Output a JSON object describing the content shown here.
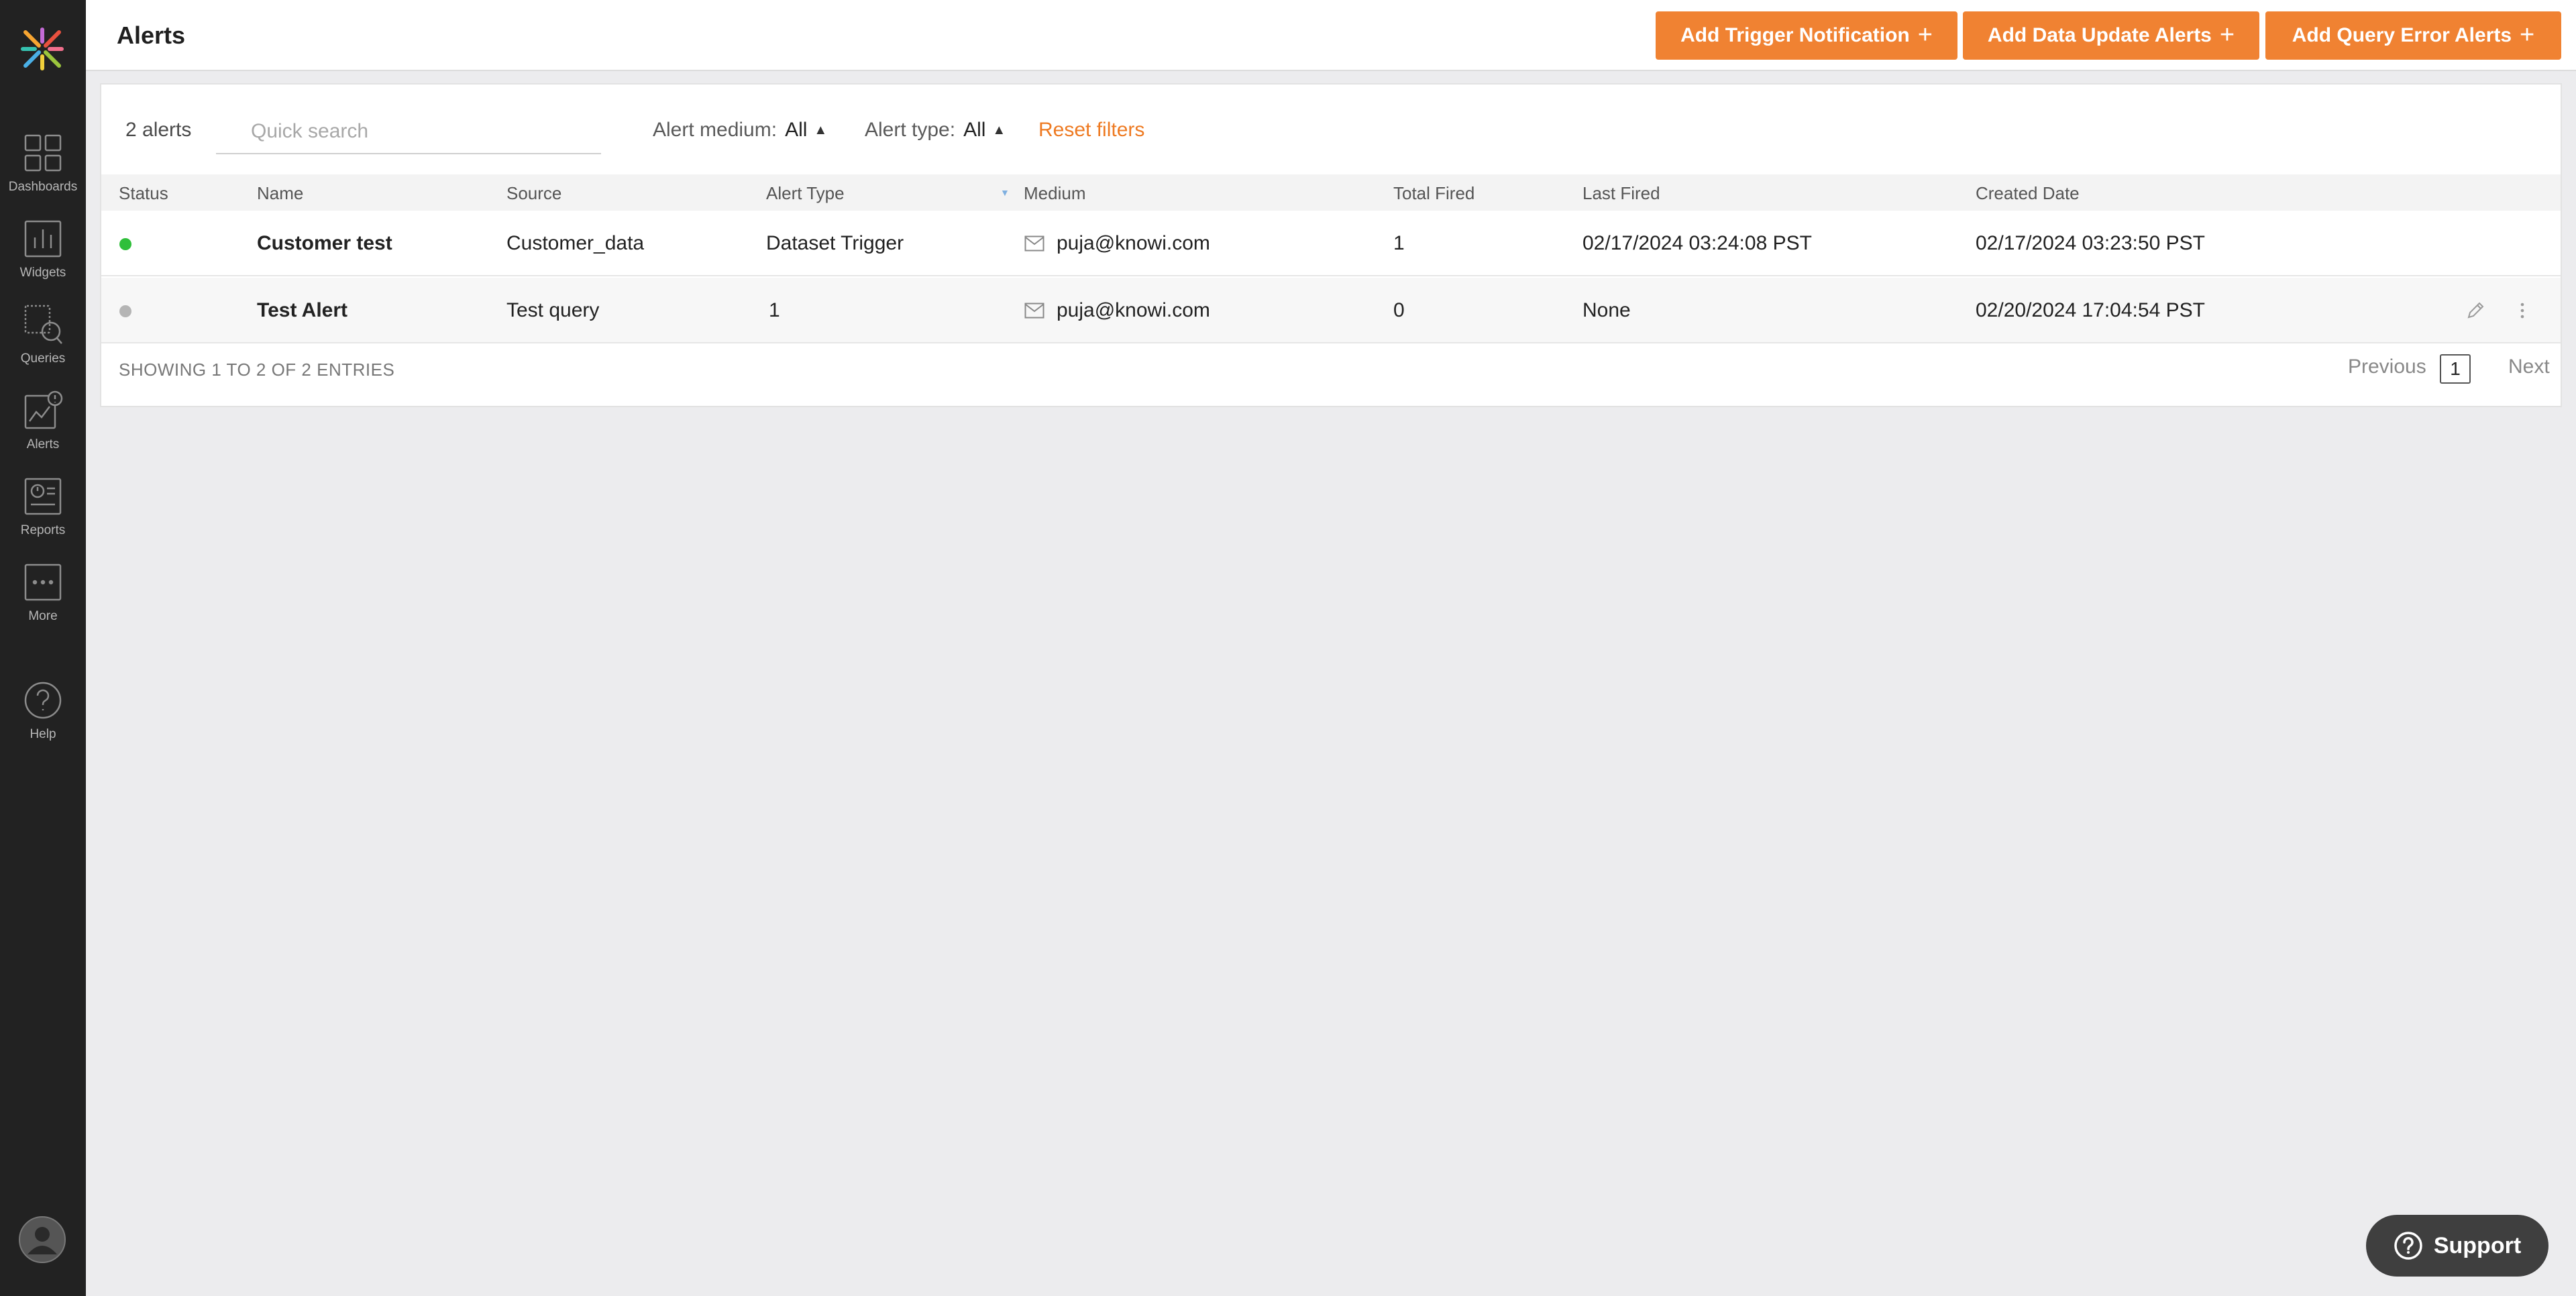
{
  "header": {
    "title": "Alerts",
    "buttons": [
      {
        "label": "Add Trigger Notification",
        "icon": "plus-icon"
      },
      {
        "label": "Add Data Update Alerts",
        "icon": "plus-icon"
      },
      {
        "label": "Add Query Error Alerts",
        "icon": "plus-icon"
      }
    ],
    "accent_color": "#f08232"
  },
  "sidebar": {
    "items": [
      {
        "label": "Dashboards",
        "icon": "dashboards-grid-icon"
      },
      {
        "label": "Widgets",
        "icon": "widgets-bar-chart-icon"
      },
      {
        "label": "Queries",
        "icon": "queries-search-icon"
      },
      {
        "label": "Alerts",
        "icon": "alerts-icon",
        "active": true
      },
      {
        "label": "Reports",
        "icon": "reports-icon"
      },
      {
        "label": "More",
        "icon": "more-dots-icon"
      },
      {
        "label": "Help",
        "icon": "help-question-icon"
      }
    ],
    "background": "#222222"
  },
  "toolbar": {
    "count_label": "2 alerts",
    "search_placeholder": "Quick search",
    "filter_medium_label": "Alert medium:",
    "filter_medium_value": "All",
    "filter_type_label": "Alert type:",
    "filter_type_value": "All",
    "reset_label": "Reset filters"
  },
  "table": {
    "columns": [
      "Status",
      "Name",
      "Source",
      "Alert Type",
      "Medium",
      "Total Fired",
      "Last Fired",
      "Created Date"
    ],
    "rows": [
      {
        "status": "active",
        "status_color": "#2fbf3a",
        "name": "Customer test",
        "source": "Customer_data",
        "alert_type": "Dataset Trigger",
        "medium": "puja@knowi.com",
        "total_fired": "1",
        "last_fired": "02/17/2024 03:24:08 PST",
        "created_date": "02/17/2024 03:23:50 PST"
      },
      {
        "status": "inactive",
        "status_color": "#b5b5b5",
        "name": "Test Alert",
        "source": "Test query",
        "alert_type": "1",
        "medium": "puja@knowi.com",
        "total_fired": "0",
        "last_fired": "None",
        "created_date": "02/20/2024 17:04:54 PST"
      }
    ]
  },
  "footer": {
    "showing": "SHOWING 1 TO 2 OF 2 ENTRIES",
    "previous": "Previous",
    "page": "1",
    "next": "Next"
  },
  "support": {
    "label": "Support"
  }
}
